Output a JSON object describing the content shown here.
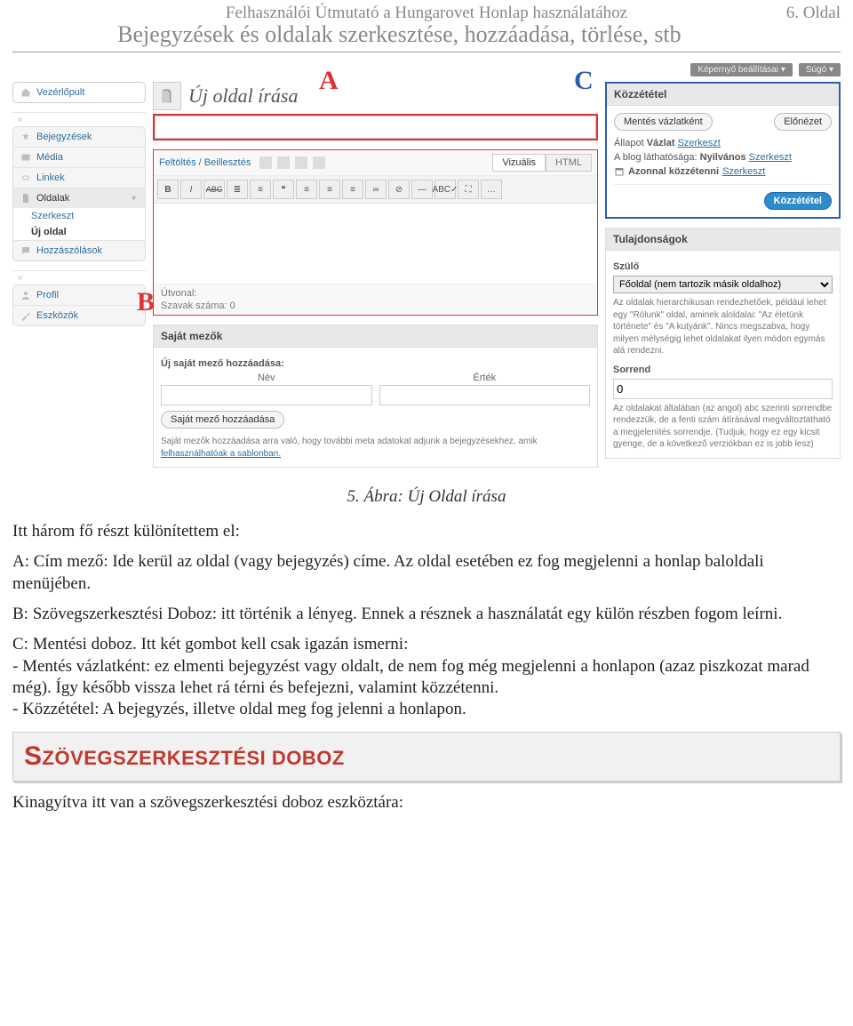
{
  "header": {
    "guide_title": "Felhasználói Útmutató a Hungarovet Honlap használatához",
    "page_num": "6. Oldal",
    "subtitle": "Bejegyzések és oldalak szerkesztése, hozzáadása, törlése, stb"
  },
  "annotations": {
    "A": "A",
    "B": "B",
    "C": "C"
  },
  "topbar": {
    "screen_options": "Képernyő beállításai",
    "help": "Súgó"
  },
  "sidebar": {
    "dashboard": "Vezérlőpult",
    "posts": "Bejegyzések",
    "media": "Média",
    "links": "Linkek",
    "pages": "Oldalak",
    "pages_sub_edit": "Szerkeszt",
    "pages_sub_new": "Új oldal",
    "comments": "Hozzászólások",
    "profile": "Profil",
    "tools": "Eszközök"
  },
  "editor": {
    "heading": "Új oldal írása",
    "upload_insert": "Feltöltés / Beillesztés",
    "tab_visual": "Vizuális",
    "tab_html": "HTML",
    "tb": {
      "b": "B",
      "i": "I",
      "abc": "ABC",
      "ul": "≣",
      "ol": "≡",
      "quote": "❝",
      "left": "≡",
      "center": "≡",
      "right": "≡",
      "link": "∞",
      "unlink": "⊘",
      "more": "—",
      "spell": "ABC✓",
      "full": "⛶",
      "kitchen": "…"
    },
    "path_label": "Útvonal:",
    "word_count": "Szavak száma: 0"
  },
  "custom_fields": {
    "title": "Saját mezők",
    "add_label": "Új saját mező hozzáadása:",
    "col_name": "Név",
    "col_value": "Érték",
    "add_btn": "Saját mező hozzáadása",
    "note_pre": "Saját mezők hozzáadása arra való, hogy további meta adatokat adjunk a bejegyzésekhez, amik ",
    "note_link": "felhasználhatóak a sablonban."
  },
  "publish": {
    "title": "Közzététel",
    "save_draft": "Mentés vázlatként",
    "preview": "Előnézet",
    "status_label": "Állapot",
    "status_value": "Vázlat",
    "edit": "Szerkeszt",
    "visibility_label": "A blog láthatósága:",
    "visibility_value": "Nyilvános",
    "schedule_label": "Azonnal közzétenni",
    "publish_btn": "Közzététel"
  },
  "attributes": {
    "title": "Tulajdonságok",
    "parent_label": "Szülő",
    "parent_select": "Főoldal (nem tartozik másik oldalhoz)",
    "parent_note": "Az oldalak hierarchikusan rendezhetőek, például lehet egy \"Rólunk\" oldal, aminek aloldalai: \"Az életünk története\" és \"A kutyánk\". Nincs megszabva, hogy milyen mélységig lehet oldalakat ilyen módon egymás alá rendezni.",
    "order_label": "Sorrend",
    "order_value": "0",
    "order_note": "Az oldalakat általában (az angol) abc szerinti sorrendbe rendezzük, de a fenti szám átírásával megváltoztatható a megjelenítés sorrendje. (Tudjuk, hogy ez egy kicsit gyenge, de a következő verziókban ez is jobb lesz)"
  },
  "caption": "5. Ábra: Új Oldal írása",
  "body": {
    "p1": "Itt három fő részt különítettem el:",
    "pA": "A: Cím mező: Ide kerül az oldal (vagy bejegyzés) címe. Az oldal esetében ez fog megjelenni a honlap baloldali menüjében.",
    "pB": "B: Szövegszerkesztési Doboz: itt történik a lényeg. Ennek a résznek a használatát egy külön részben fogom leírni.",
    "pC1": "C: Mentési doboz. Itt két gombot kell csak igazán ismerni:",
    "pC2": "- Mentés vázlatként: ez elmenti bejegyzést vagy oldalt, de nem fog még megjelenni a honlapon (azaz piszkozat marad még). Így később vissza lehet rá térni és befejezni, valamint közzétenni.",
    "pC3": "- Közzététel: A bejegyzés, illetve oldal meg fog jelenni a honlapon."
  },
  "section_heading": {
    "first": "S",
    "rest": "ZÖVEGSZERKESZTÉSI DOBOZ"
  },
  "closing": "Kinagyítva itt van a szövegszerkesztési doboz eszköztára:"
}
